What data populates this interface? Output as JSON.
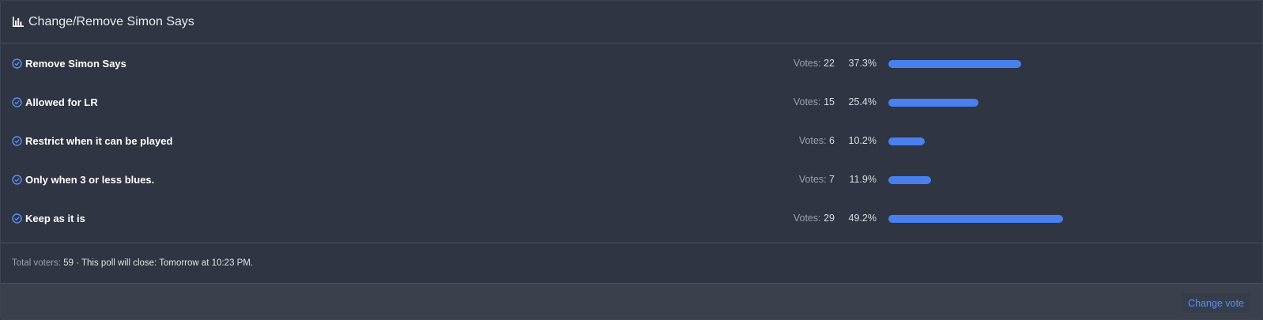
{
  "poll": {
    "title": "Change/Remove Simon Says",
    "votes_prefix": "Votes: ",
    "options": [
      {
        "label": "Remove Simon Says",
        "votes": "22",
        "percent": "37.3%",
        "fraction": 0.373
      },
      {
        "label": "Allowed for LR",
        "votes": "15",
        "percent": "25.4%",
        "fraction": 0.254
      },
      {
        "label": "Restrict when it can be played",
        "votes": "6",
        "percent": "10.2%",
        "fraction": 0.102
      },
      {
        "label": "Only when 3 or less blues.",
        "votes": "7",
        "percent": "11.9%",
        "fraction": 0.119
      },
      {
        "label": "Keep as it is",
        "votes": "29",
        "percent": "49.2%",
        "fraction": 0.492
      }
    ],
    "summary": {
      "total_label": "Total voters: ",
      "total_value": "59",
      "separator": " · ",
      "close_text": "This poll will close: Tomorrow at 10:23 PM."
    },
    "change_vote_label": "Change vote"
  },
  "colors": {
    "accent": "#4a7ff0",
    "background": "#2f3543",
    "footer": "#3b414c"
  },
  "icons": {
    "header": "bar-chart-icon",
    "option": "check-circle-icon"
  }
}
